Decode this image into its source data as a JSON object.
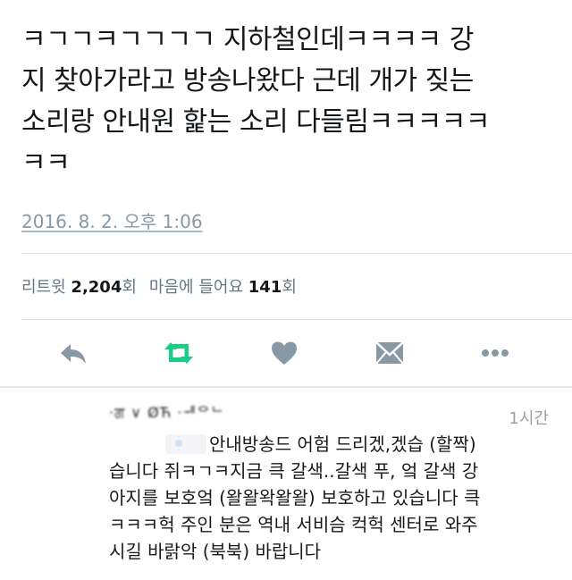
{
  "tweet": {
    "text": "ㅋㄱㄱㅋㄱㄱㄱㄱ 지하철인데ㅋㅋㅋㅋ 강\n지 찾아가라고 방송나왔다 근데 개가 짖는\n소리랑 안내원 핥는 소리 다들림ㅋㅋㅋㅋㅋ\nㅋㅋ",
    "timestamp": "2016. 8. 2. 오후 1:06",
    "stats": {
      "retweet_label": "리트윗",
      "retweet_count": "2,204",
      "retweet_unit": "회",
      "like_label": "마음에 들어요",
      "like_count": "141",
      "like_unit": "회"
    },
    "actions": [
      {
        "name": "reply",
        "icon": "reply-icon"
      },
      {
        "name": "retweet",
        "icon": "retweet-icon"
      },
      {
        "name": "like",
        "icon": "heart-icon"
      },
      {
        "name": "direct-message",
        "icon": "envelope-icon"
      },
      {
        "name": "more",
        "icon": "more-icon"
      }
    ],
    "colors": {
      "retweet_active": "#19cf86",
      "icon_gray": "#8899a6",
      "meta_gray": "#8899a6"
    }
  },
  "reply": {
    "author": "·ਗ ∨ ØЋ  ·ᆌᄋᄂ",
    "time": "1시간",
    "lines": [
      "안내방송드 어험 드리겠,겠습 (할짝)",
      "습니다 쥐ㅋㄱㅋ지금 큭 갈색..갈색 푸, 엌 갈색 강",
      "아지를 보호엌 (왈왈왁왈왈) 보호하고 있습니다 큭",
      "ㅋㅋㅋ헉 주인 분은 역내 서비슴 컥헉 센터로 와주",
      "시길 바랅악 (북북) 바랍니다"
    ]
  }
}
